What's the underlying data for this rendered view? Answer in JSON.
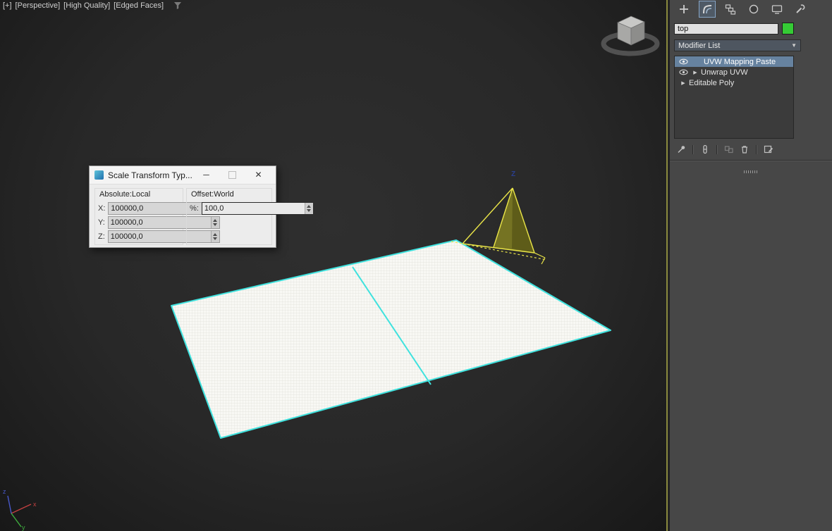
{
  "viewport": {
    "menus": {
      "general": "[+]",
      "pov": "[Perspective]",
      "quality": "[High Quality]",
      "shading": "[Edged Faces]"
    },
    "tripod": {
      "x": "x",
      "y": "y",
      "z": "z"
    },
    "gizmo_axis_label": "Z"
  },
  "dialog": {
    "title": "Scale Transform Typ...",
    "controls": {
      "minimize": "─",
      "close": "✕"
    },
    "groups": {
      "absolute": "Absolute:Local",
      "offset": "Offset:World"
    },
    "fields": {
      "x_label": "X:",
      "x_value": "100000,0",
      "y_label": "Y:",
      "y_value": "100000,0",
      "z_label": "Z:",
      "z_value": "100000,0",
      "pct_label": "%:",
      "pct_value": "100,0"
    }
  },
  "panel": {
    "object_name": "top",
    "modifier_list_label": "Modifier List",
    "dropdown_arrow": "▼",
    "expand_arrow": "▶",
    "stack": [
      {
        "label": "UVW Mapping Paste",
        "selected": true,
        "visible_eye": true
      },
      {
        "label": "Unwrap UVW",
        "selected": false,
        "visible_eye": true
      },
      {
        "label": "Editable Poly",
        "selected": false,
        "visible_eye": false
      }
    ]
  },
  "colors": {
    "selection_blue": "#66829f",
    "edge_cyan": "#3fe2de",
    "gizmo_yellow": "#e9e448",
    "object_color_green": "#35cb35",
    "viewport_border": "#8a8a3e"
  }
}
